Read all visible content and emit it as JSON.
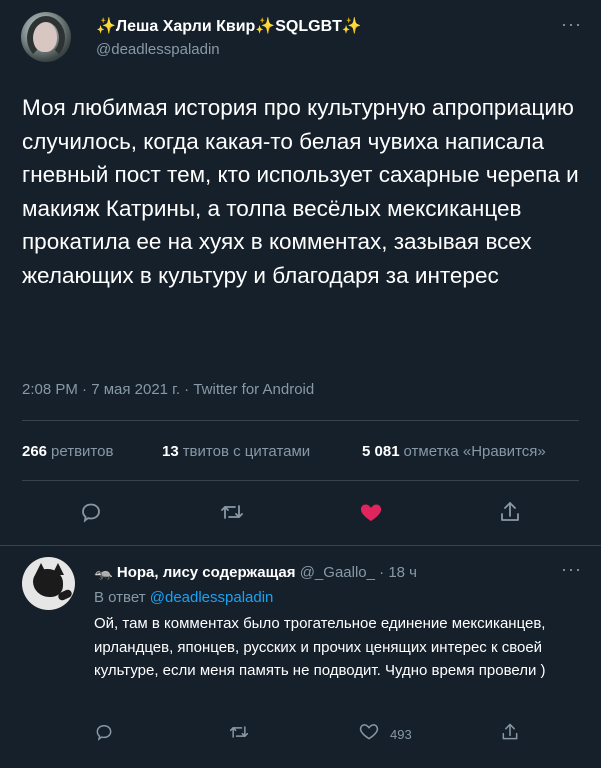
{
  "tweet": {
    "author_name": "✨Леша Харли Квир✨SQLGBT✨",
    "handle": "@deadlesspaladin",
    "more": "···",
    "text": "Моя любимая история про культурную апроприацию случилось, когда какая-то белая чувиха написала гневный пост тем, кто использует сахарные черепа и макияж Катрины, а толпа весёлых мексиканцев прокатила ее на хуях в комментах, зазывая всех желающих в культуру и благодаря за интерес",
    "meta": "2:08 PM · 7 мая 2021 г. · Twitter for Android",
    "stats": {
      "retweets_count": "266",
      "retweets_label": "ретвитов",
      "quotes_count": "13",
      "quotes_label": "твитов с цитатами",
      "likes_count": "5 081",
      "likes_label": "отметка «Нравится»"
    },
    "actions": [
      "reply-icon",
      "retweet-icon",
      "heart-filled-icon",
      "share-icon"
    ],
    "liked_color": "#e0245e"
  },
  "reply": {
    "emoji": "🦡",
    "author_name": "Нора, лису содержащая",
    "handle": "@_Gaallo_",
    "time": "· 18 ч",
    "more": "···",
    "reply_prefix": "В ответ",
    "reply_to": "@deadlesspaladin",
    "text": "Ой, там в комментах было трогательное единение мексиканцев, ирландцев, японцев, русских и прочих ценящих интерес к своей культуре, если меня память не подводит. Чудно время провели )",
    "like_count": "493",
    "actions": [
      "reply-icon",
      "retweet-icon",
      "heart-icon",
      "share-icon"
    ]
  },
  "colors": {
    "background": "#15202b",
    "muted": "#8899a6",
    "accent": "#1da1f2",
    "divider": "#38444d"
  }
}
